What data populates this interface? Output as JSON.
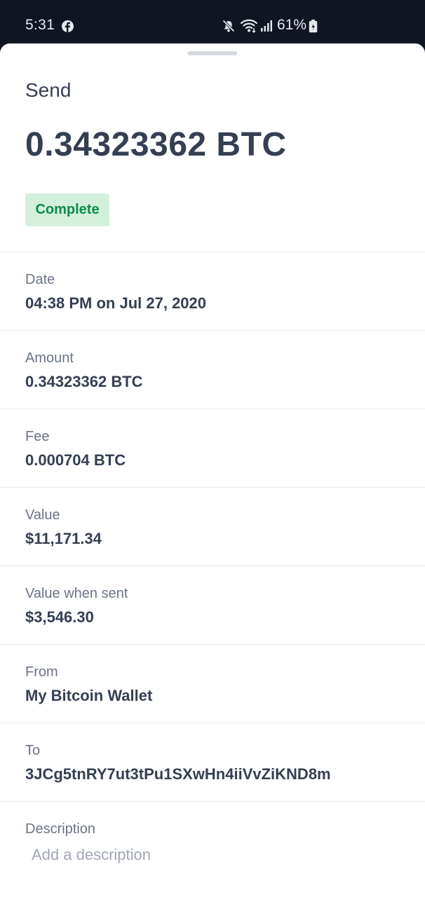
{
  "status_bar": {
    "time": "5:31",
    "battery": "61%",
    "icons": [
      "facebook-icon",
      "mute-icon",
      "wifi-icon",
      "signal-icon",
      "battery-icon"
    ]
  },
  "transaction": {
    "title": "Send",
    "amount": "0.34323362 BTC",
    "status": "Complete"
  },
  "details": [
    {
      "label": "Date",
      "value": "04:38 PM on Jul 27, 2020"
    },
    {
      "label": "Amount",
      "value": "0.34323362 BTC"
    },
    {
      "label": "Fee",
      "value": "0.000704 BTC"
    },
    {
      "label": "Value",
      "value": "$11,171.34"
    },
    {
      "label": "Value when sent",
      "value": "$3,546.30"
    },
    {
      "label": "From",
      "value": "My Bitcoin Wallet"
    },
    {
      "label": "To",
      "value": "3JCg5tnRY7ut3tPu1SXwHn4iiVvZiKND8m"
    }
  ],
  "description": {
    "label": "Description",
    "value": "",
    "placeholder": "Add a description"
  },
  "colors": {
    "heading": "#353f52",
    "label": "#6b7484",
    "badge_bg": "#d3f0dc",
    "badge_text": "#0f8a4a",
    "status_bar_bg": "#0f1521"
  }
}
